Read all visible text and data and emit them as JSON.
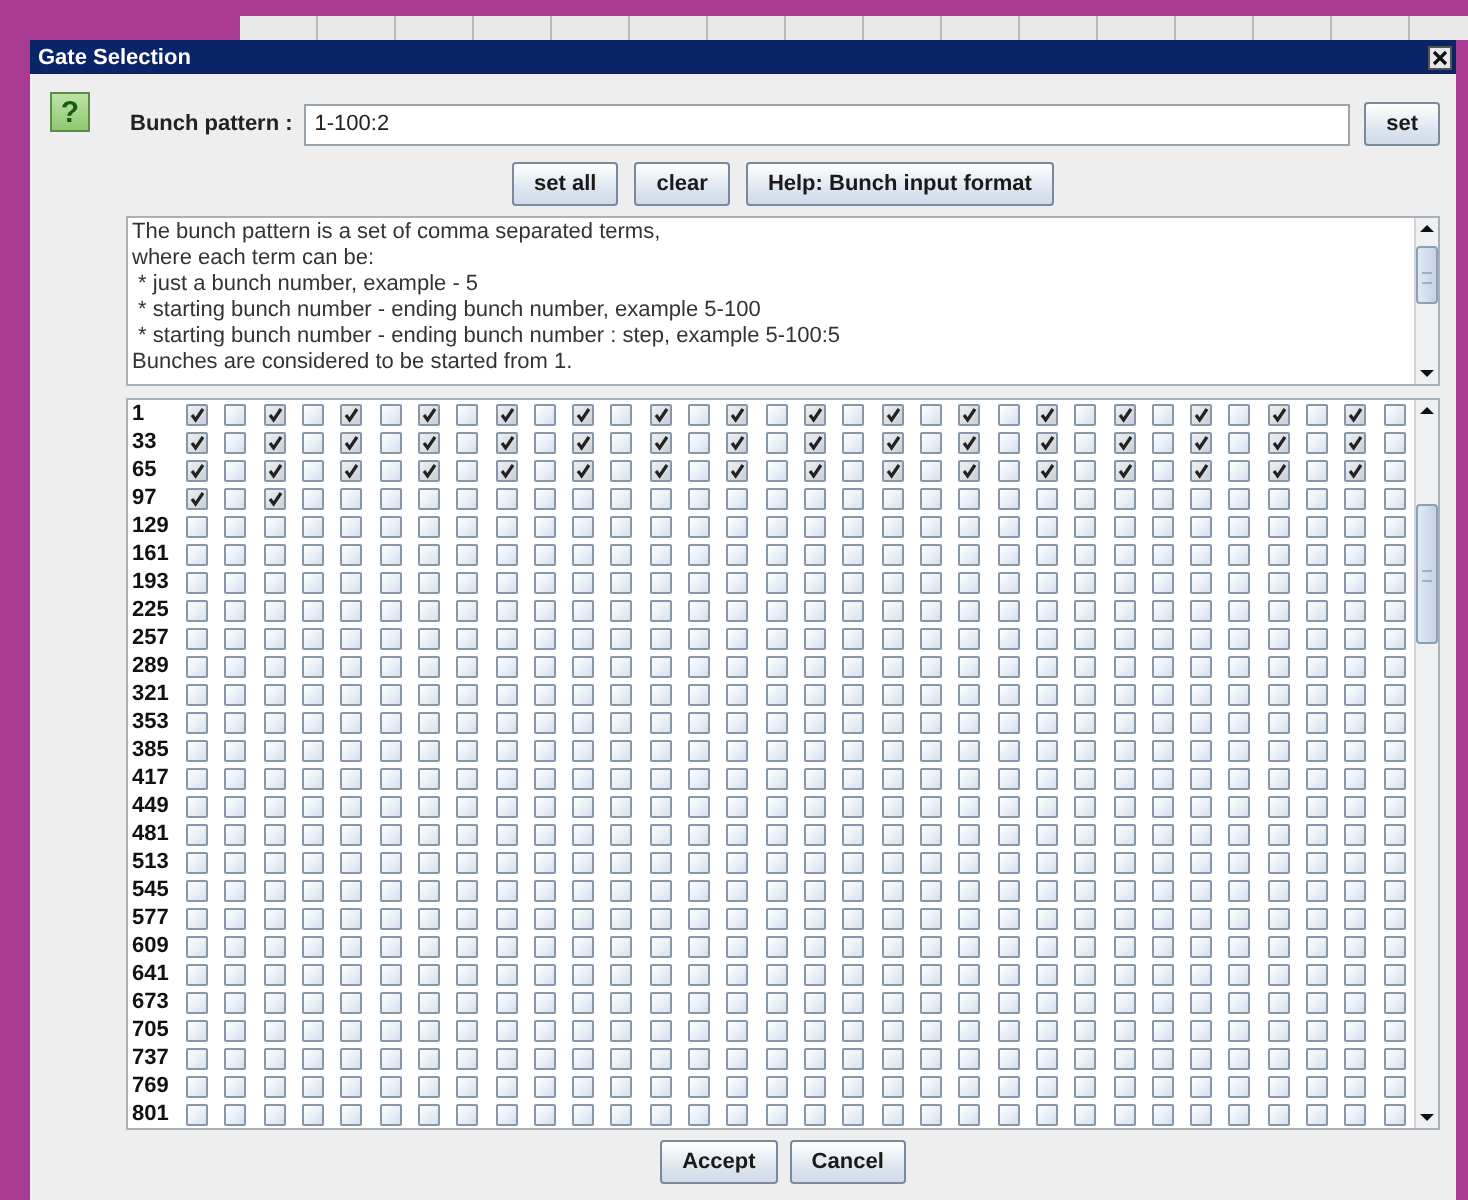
{
  "window": {
    "title": "Gate Selection"
  },
  "help_icon": "?",
  "bunch_pattern": {
    "label": "Bunch pattern :",
    "value": "1-100:2",
    "button": "set"
  },
  "buttons": [
    "set all",
    "clear",
    "Help: Bunch input format"
  ],
  "help_text": [
    "The bunch pattern is a set of comma separated terms,",
    "where each term can be:",
    " * just a bunch number, example - 5",
    " * starting bunch number - ending bunch number, example 5-100",
    " * starting bunch number - ending bunch number : step, example 5-100:5",
    "Bunches are considered to be started from 1."
  ],
  "grid": {
    "rows": [
      {
        "label": "1",
        "checks": [
          true,
          false,
          true,
          false,
          true,
          false,
          true,
          false,
          true,
          false,
          true,
          false,
          true,
          false,
          true,
          false,
          true,
          false,
          true,
          false,
          true,
          false,
          true,
          false,
          true,
          false,
          true,
          false,
          true,
          false,
          true,
          false
        ]
      },
      {
        "label": "33",
        "checks": [
          true,
          false,
          true,
          false,
          true,
          false,
          true,
          false,
          true,
          false,
          true,
          false,
          true,
          false,
          true,
          false,
          true,
          false,
          true,
          false,
          true,
          false,
          true,
          false,
          true,
          false,
          true,
          false,
          true,
          false,
          true,
          false
        ]
      },
      {
        "label": "65",
        "checks": [
          true,
          false,
          true,
          false,
          true,
          false,
          true,
          false,
          true,
          false,
          true,
          false,
          true,
          false,
          true,
          false,
          true,
          false,
          true,
          false,
          true,
          false,
          true,
          false,
          true,
          false,
          true,
          false,
          true,
          false,
          true,
          false
        ]
      },
      {
        "label": "97",
        "checks": [
          true,
          false,
          true,
          false,
          false,
          false,
          false,
          false,
          false,
          false,
          false,
          false,
          false,
          false,
          false,
          false,
          false,
          false,
          false,
          false,
          false,
          false,
          false,
          false,
          false,
          false,
          false,
          false,
          false,
          false,
          false,
          false
        ]
      },
      {
        "label": "129",
        "checks": [
          false,
          false,
          false,
          false,
          false,
          false,
          false,
          false,
          false,
          false,
          false,
          false,
          false,
          false,
          false,
          false,
          false,
          false,
          false,
          false,
          false,
          false,
          false,
          false,
          false,
          false,
          false,
          false,
          false,
          false,
          false,
          false
        ]
      },
      {
        "label": "161",
        "checks": [
          false,
          false,
          false,
          false,
          false,
          false,
          false,
          false,
          false,
          false,
          false,
          false,
          false,
          false,
          false,
          false,
          false,
          false,
          false,
          false,
          false,
          false,
          false,
          false,
          false,
          false,
          false,
          false,
          false,
          false,
          false,
          false
        ]
      },
      {
        "label": "193",
        "checks": [
          false,
          false,
          false,
          false,
          false,
          false,
          false,
          false,
          false,
          false,
          false,
          false,
          false,
          false,
          false,
          false,
          false,
          false,
          false,
          false,
          false,
          false,
          false,
          false,
          false,
          false,
          false,
          false,
          false,
          false,
          false,
          false
        ]
      },
      {
        "label": "225",
        "checks": [
          false,
          false,
          false,
          false,
          false,
          false,
          false,
          false,
          false,
          false,
          false,
          false,
          false,
          false,
          false,
          false,
          false,
          false,
          false,
          false,
          false,
          false,
          false,
          false,
          false,
          false,
          false,
          false,
          false,
          false,
          false,
          false
        ]
      },
      {
        "label": "257",
        "checks": [
          false,
          false,
          false,
          false,
          false,
          false,
          false,
          false,
          false,
          false,
          false,
          false,
          false,
          false,
          false,
          false,
          false,
          false,
          false,
          false,
          false,
          false,
          false,
          false,
          false,
          false,
          false,
          false,
          false,
          false,
          false,
          false
        ]
      },
      {
        "label": "289",
        "checks": [
          false,
          false,
          false,
          false,
          false,
          false,
          false,
          false,
          false,
          false,
          false,
          false,
          false,
          false,
          false,
          false,
          false,
          false,
          false,
          false,
          false,
          false,
          false,
          false,
          false,
          false,
          false,
          false,
          false,
          false,
          false,
          false
        ]
      },
      {
        "label": "321",
        "checks": [
          false,
          false,
          false,
          false,
          false,
          false,
          false,
          false,
          false,
          false,
          false,
          false,
          false,
          false,
          false,
          false,
          false,
          false,
          false,
          false,
          false,
          false,
          false,
          false,
          false,
          false,
          false,
          false,
          false,
          false,
          false,
          false
        ]
      },
      {
        "label": "353",
        "checks": [
          false,
          false,
          false,
          false,
          false,
          false,
          false,
          false,
          false,
          false,
          false,
          false,
          false,
          false,
          false,
          false,
          false,
          false,
          false,
          false,
          false,
          false,
          false,
          false,
          false,
          false,
          false,
          false,
          false,
          false,
          false,
          false
        ]
      },
      {
        "label": "385",
        "checks": [
          false,
          false,
          false,
          false,
          false,
          false,
          false,
          false,
          false,
          false,
          false,
          false,
          false,
          false,
          false,
          false,
          false,
          false,
          false,
          false,
          false,
          false,
          false,
          false,
          false,
          false,
          false,
          false,
          false,
          false,
          false,
          false
        ]
      },
      {
        "label": "417",
        "checks": [
          false,
          false,
          false,
          false,
          false,
          false,
          false,
          false,
          false,
          false,
          false,
          false,
          false,
          false,
          false,
          false,
          false,
          false,
          false,
          false,
          false,
          false,
          false,
          false,
          false,
          false,
          false,
          false,
          false,
          false,
          false,
          false
        ]
      },
      {
        "label": "449",
        "checks": [
          false,
          false,
          false,
          false,
          false,
          false,
          false,
          false,
          false,
          false,
          false,
          false,
          false,
          false,
          false,
          false,
          false,
          false,
          false,
          false,
          false,
          false,
          false,
          false,
          false,
          false,
          false,
          false,
          false,
          false,
          false,
          false
        ]
      },
      {
        "label": "481",
        "checks": [
          false,
          false,
          false,
          false,
          false,
          false,
          false,
          false,
          false,
          false,
          false,
          false,
          false,
          false,
          false,
          false,
          false,
          false,
          false,
          false,
          false,
          false,
          false,
          false,
          false,
          false,
          false,
          false,
          false,
          false,
          false,
          false
        ]
      },
      {
        "label": "513",
        "checks": [
          false,
          false,
          false,
          false,
          false,
          false,
          false,
          false,
          false,
          false,
          false,
          false,
          false,
          false,
          false,
          false,
          false,
          false,
          false,
          false,
          false,
          false,
          false,
          false,
          false,
          false,
          false,
          false,
          false,
          false,
          false,
          false
        ]
      },
      {
        "label": "545",
        "checks": [
          false,
          false,
          false,
          false,
          false,
          false,
          false,
          false,
          false,
          false,
          false,
          false,
          false,
          false,
          false,
          false,
          false,
          false,
          false,
          false,
          false,
          false,
          false,
          false,
          false,
          false,
          false,
          false,
          false,
          false,
          false,
          false
        ]
      },
      {
        "label": "577",
        "checks": [
          false,
          false,
          false,
          false,
          false,
          false,
          false,
          false,
          false,
          false,
          false,
          false,
          false,
          false,
          false,
          false,
          false,
          false,
          false,
          false,
          false,
          false,
          false,
          false,
          false,
          false,
          false,
          false,
          false,
          false,
          false,
          false
        ]
      },
      {
        "label": "609",
        "checks": [
          false,
          false,
          false,
          false,
          false,
          false,
          false,
          false,
          false,
          false,
          false,
          false,
          false,
          false,
          false,
          false,
          false,
          false,
          false,
          false,
          false,
          false,
          false,
          false,
          false,
          false,
          false,
          false,
          false,
          false,
          false,
          false
        ]
      },
      {
        "label": "641",
        "checks": [
          false,
          false,
          false,
          false,
          false,
          false,
          false,
          false,
          false,
          false,
          false,
          false,
          false,
          false,
          false,
          false,
          false,
          false,
          false,
          false,
          false,
          false,
          false,
          false,
          false,
          false,
          false,
          false,
          false,
          false,
          false,
          false
        ]
      },
      {
        "label": "673",
        "checks": [
          false,
          false,
          false,
          false,
          false,
          false,
          false,
          false,
          false,
          false,
          false,
          false,
          false,
          false,
          false,
          false,
          false,
          false,
          false,
          false,
          false,
          false,
          false,
          false,
          false,
          false,
          false,
          false,
          false,
          false,
          false,
          false
        ]
      },
      {
        "label": "705",
        "checks": [
          false,
          false,
          false,
          false,
          false,
          false,
          false,
          false,
          false,
          false,
          false,
          false,
          false,
          false,
          false,
          false,
          false,
          false,
          false,
          false,
          false,
          false,
          false,
          false,
          false,
          false,
          false,
          false,
          false,
          false,
          false,
          false
        ]
      },
      {
        "label": "737",
        "checks": [
          false,
          false,
          false,
          false,
          false,
          false,
          false,
          false,
          false,
          false,
          false,
          false,
          false,
          false,
          false,
          false,
          false,
          false,
          false,
          false,
          false,
          false,
          false,
          false,
          false,
          false,
          false,
          false,
          false,
          false,
          false,
          false
        ]
      },
      {
        "label": "769",
        "checks": [
          false,
          false,
          false,
          false,
          false,
          false,
          false,
          false,
          false,
          false,
          false,
          false,
          false,
          false,
          false,
          false,
          false,
          false,
          false,
          false,
          false,
          false,
          false,
          false,
          false,
          false,
          false,
          false,
          false,
          false,
          false,
          false
        ]
      },
      {
        "label": "801",
        "checks": [
          false,
          false,
          false,
          false,
          false,
          false,
          false,
          false,
          false,
          false,
          false,
          false,
          false,
          false,
          false,
          false,
          false,
          false,
          false,
          false,
          false,
          false,
          false,
          false,
          false,
          false,
          false,
          false,
          false,
          false,
          false,
          false
        ]
      }
    ]
  },
  "footer_buttons": [
    "Accept",
    "Cancel"
  ]
}
